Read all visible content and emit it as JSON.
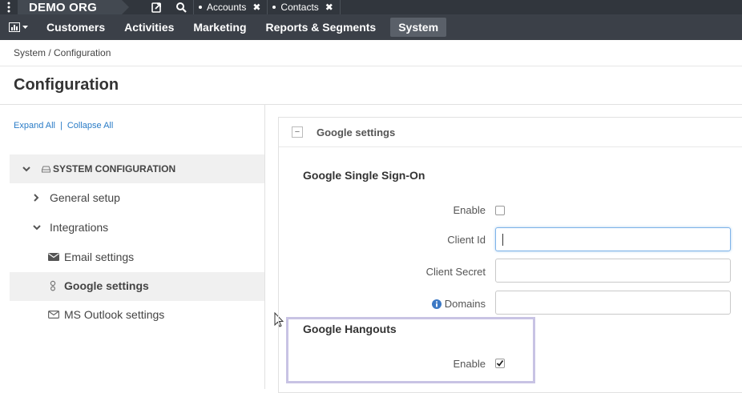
{
  "topbar": {
    "org_name": "DEMO ORG",
    "tabs": [
      {
        "label": "Accounts",
        "close": "✖"
      },
      {
        "label": "Contacts",
        "close": "✖"
      }
    ]
  },
  "nav": {
    "items": [
      "Customers",
      "Activities",
      "Marketing",
      "Reports & Segments",
      "System"
    ],
    "active": "System"
  },
  "breadcrumb": "System / Configuration",
  "page_title": "Configuration",
  "sidebar": {
    "expand_all": "Expand All",
    "separator": "|",
    "collapse_all": "Collapse All",
    "system_configuration": "SYSTEM CONFIGURATION",
    "general_setup": "General setup",
    "integrations": "Integrations",
    "email_settings": "Email settings",
    "google_settings": "Google settings",
    "ms_outlook_settings": "MS Outlook settings"
  },
  "panel": {
    "title": "Google settings",
    "collapse_symbol": "−",
    "sso_title": "Google Single Sign-On",
    "enable_label": "Enable",
    "client_id_label": "Client Id",
    "client_id_value": "",
    "client_secret_label": "Client Secret",
    "client_secret_value": "",
    "domains_label": "Domains",
    "domains_value": "",
    "sso_enabled": false,
    "hangouts_title": "Google Hangouts",
    "hangouts_enable_label": "Enable",
    "hangouts_enabled": true
  },
  "colors": {
    "topbar": "#31363d",
    "navbar": "#3b4048",
    "link": "#2a7cc7",
    "highlight": "#c8c3e4"
  }
}
